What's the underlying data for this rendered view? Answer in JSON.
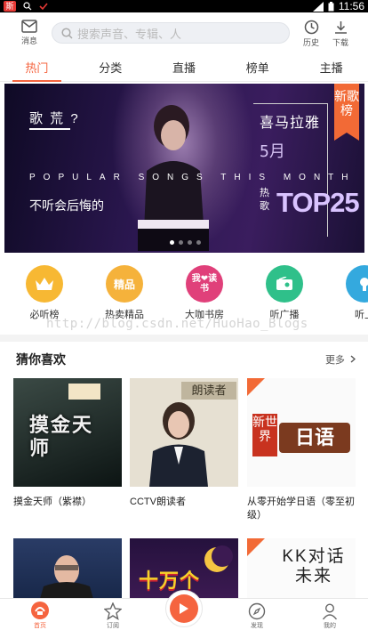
{
  "statusbar": {
    "app_badge": "斯",
    "time": "11:56"
  },
  "header": {
    "message_label": "消息",
    "search_placeholder": "搜索声音、专辑、人",
    "history_label": "历史",
    "download_label": "下载"
  },
  "tabs": [
    {
      "label": "热门",
      "active": true
    },
    {
      "label": "分类"
    },
    {
      "label": "直播"
    },
    {
      "label": "榜单"
    },
    {
      "label": "主播"
    }
  ],
  "banner": {
    "headline": "歌 荒 ?",
    "subtitle": "POPULAR SONGS THIS MONTH",
    "tagline": "不听会后悔的",
    "brand": "喜马拉雅",
    "month": "5月",
    "hot_label": "热歌",
    "top_label": "TOP25",
    "ribbon": "新歌榜"
  },
  "categories": [
    {
      "label": "必听榜",
      "color": "#f7b833",
      "icon_text": ""
    },
    {
      "label": "热卖精品",
      "color": "#f5b23b",
      "icon_text": "精品"
    },
    {
      "label": "大咖书房",
      "color": "#e0407a",
      "icon_text": "我❤读书"
    },
    {
      "label": "听广播",
      "color": "#2fc08a",
      "icon_text": ""
    },
    {
      "label": "听上",
      "color": "#34a9de",
      "icon_text": ""
    }
  ],
  "watermark": "http://blog.csdn.net/HuoHao_Blogs",
  "section": {
    "title": "猜你喜欢",
    "more_label": "更多"
  },
  "cards": [
    {
      "title": "摸金天师（紫襟）",
      "art_text": "摸金天师"
    },
    {
      "title": "CCTV朗读者",
      "art_text": "朗读者"
    },
    {
      "title": "从零开始学日语（零至初级）",
      "art_text": "新世界日语"
    },
    {
      "title": "",
      "art_text": ""
    },
    {
      "title": "",
      "art_text": "十万个"
    },
    {
      "title": "",
      "art_text": "KK对话未来"
    }
  ],
  "bottomnav": [
    {
      "label": "首页",
      "active": true
    },
    {
      "label": "订阅"
    },
    {
      "label": ""
    },
    {
      "label": "发现"
    },
    {
      "label": "我的"
    }
  ]
}
